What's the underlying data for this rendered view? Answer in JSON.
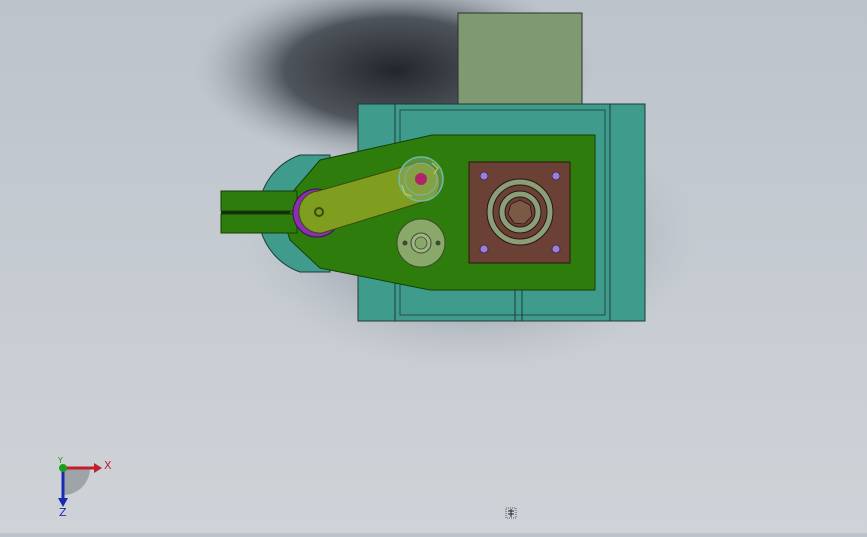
{
  "viewport": {
    "background_top": "#bcc3cb",
    "background_bottom": "#cfd3d8",
    "model_colors": {
      "base_plate": "#3f9c8c",
      "motor_block": "#7f9a72",
      "arm_plate": "#2e7d0c",
      "link_bar": "#7f9d1f",
      "eccentric_disc": "#8a2fb0",
      "flange_plate": "#6b4136",
      "bearing_ring": "#8a9e78",
      "bushing": "#8aa86a"
    }
  },
  "triad": {
    "x_label": "X",
    "y_label": "Y",
    "z_label": "Z",
    "x_color": "#c0202a",
    "y_color": "#1aa01a",
    "z_color": "#1a2ab0"
  },
  "cursor": {
    "icon": "busy-cursor-icon"
  }
}
